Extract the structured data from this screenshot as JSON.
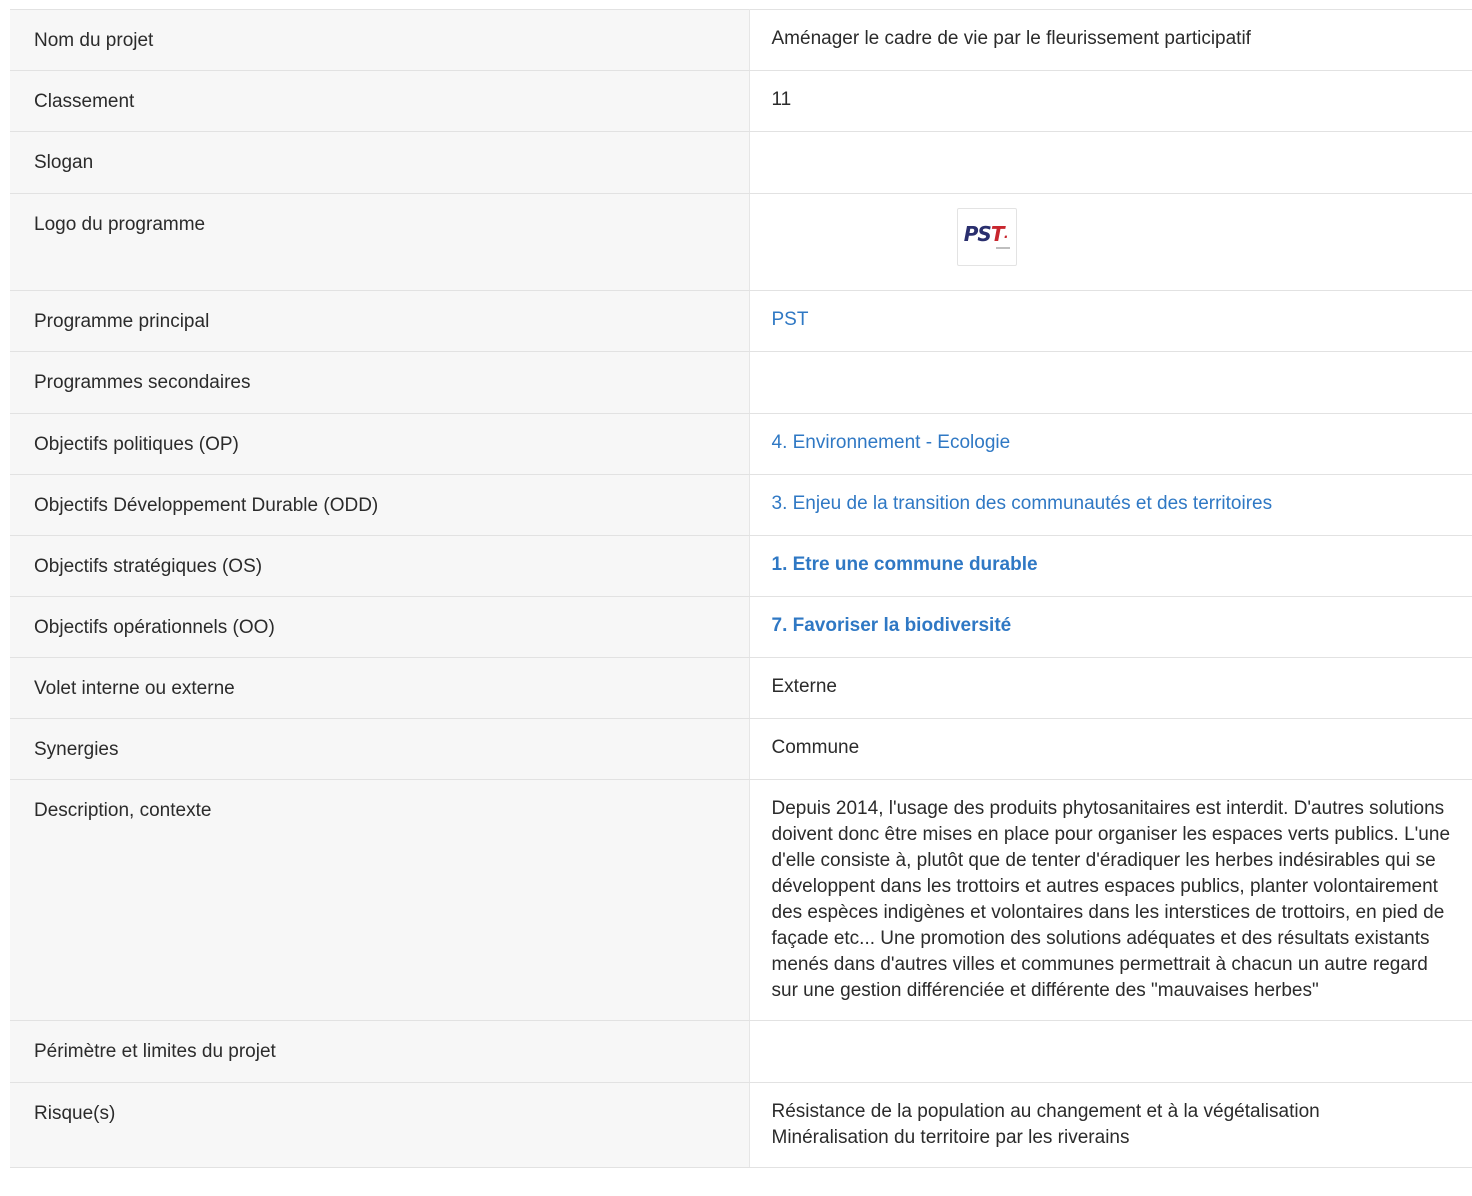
{
  "rows": {
    "nom": {
      "label": "Nom du projet",
      "value": "Aménager le cadre de vie par le fleurissement participatif"
    },
    "classement": {
      "label": "Classement",
      "value": "11"
    },
    "slogan": {
      "label": "Slogan",
      "value": ""
    },
    "logo": {
      "label": "Logo du programme",
      "logo_text": "PST"
    },
    "programme_principal": {
      "label": "Programme principal",
      "value": "PST"
    },
    "programmes_secondaires": {
      "label": "Programmes secondaires",
      "value": ""
    },
    "op": {
      "label": "Objectifs politiques (OP)",
      "value": "4. Environnement - Ecologie"
    },
    "odd": {
      "label": "Objectifs Développement Durable (ODD)",
      "value": "3. Enjeu de la transition des communautés et des territoires"
    },
    "os": {
      "label": "Objectifs stratégiques (OS)",
      "value": "1. Etre une commune durable"
    },
    "oo": {
      "label": "Objectifs opérationnels (OO)",
      "value": "7. Favoriser la biodiversité"
    },
    "volet": {
      "label": "Volet interne ou externe",
      "value": "Externe"
    },
    "synergies": {
      "label": "Synergies",
      "value": "Commune"
    },
    "description": {
      "label": "Description, contexte",
      "value": "Depuis 2014, l'usage des produits phytosanitaires est interdit. D'autres solutions doivent donc être mises en place pour organiser les espaces verts publics. L'une d'elle consiste à, plutôt que de tenter d'éradiquer les herbes indésirables qui se développent dans les trottoirs et autres espaces publics, planter volontairement des espèces indigènes et volontaires dans les interstices de trottoirs, en pied de façade etc... Une promotion des solutions adéquates et des résultats existants menés dans d'autres villes et communes permettrait à chacun un autre regard sur une gestion différenciée et différente des \"mauvaises herbes\""
    },
    "perimetre": {
      "label": "Périmètre et limites du projet",
      "value": ""
    },
    "risques": {
      "label": "Risque(s)",
      "value": "Résistance de la population au changement et à la végétalisation\nMinéralisation du territoire par les riverains"
    }
  },
  "colors": {
    "link": "#2f78c4",
    "label_bg": "#f7f7f7",
    "border": "#e2e2e2"
  }
}
